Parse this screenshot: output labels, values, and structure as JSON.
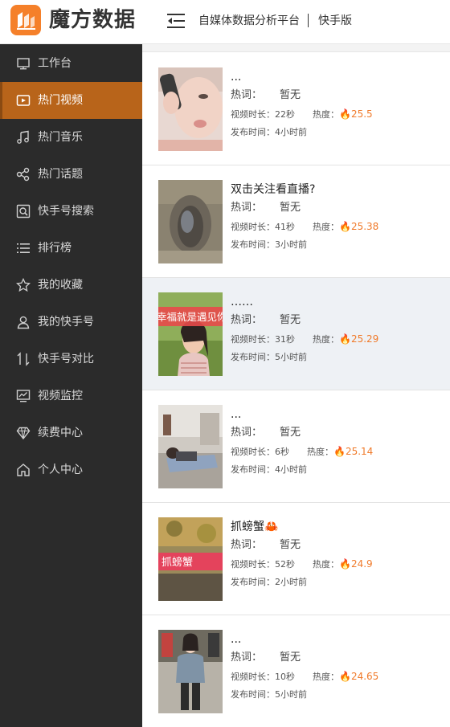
{
  "header": {
    "brand": "魔方数据",
    "platform": "自媒体数据分析平台",
    "edition": "快手版",
    "accent_color": "#f5802a"
  },
  "sidebar": {
    "items": [
      {
        "label": "工作台",
        "icon": "monitor-icon"
      },
      {
        "label": "热门视频",
        "icon": "play-icon",
        "active": true
      },
      {
        "label": "热门音乐",
        "icon": "music-note-icon"
      },
      {
        "label": "热门话题",
        "icon": "share-nodes-icon"
      },
      {
        "label": "快手号搜索",
        "icon": "search-box-icon"
      },
      {
        "label": "排行榜",
        "icon": "list-icon"
      },
      {
        "label": "我的收藏",
        "icon": "star-icon"
      },
      {
        "label": "我的快手号",
        "icon": "user-icon"
      },
      {
        "label": "快手号对比",
        "icon": "compare-arrows-icon"
      },
      {
        "label": "视频监控",
        "icon": "chart-monitor-icon"
      },
      {
        "label": "续费中心",
        "icon": "diamond-icon"
      },
      {
        "label": "个人中心",
        "icon": "home-icon"
      }
    ],
    "active_color": "#b8641a"
  },
  "videos": [
    {
      "title": "...",
      "keyword_label": "热词：",
      "keyword": "暂无",
      "duration_label": "视频时长：",
      "duration": "22秒",
      "heat_label": "热度：",
      "heat": "25.5",
      "publish_label": "发布时间：",
      "publish": "4小时前"
    },
    {
      "title": "双击关注看直播?",
      "keyword_label": "热词：",
      "keyword": "暂无",
      "duration_label": "视频时长：",
      "duration": "41秒",
      "heat_label": "热度：",
      "heat": "25.38",
      "publish_label": "发布时间：",
      "publish": "3小时前"
    },
    {
      "title": "……",
      "keyword_label": "热词：",
      "keyword": "暂无",
      "duration_label": "视频时长：",
      "duration": "31秒",
      "heat_label": "热度：",
      "heat": "25.29",
      "publish_label": "发布时间：",
      "publish": "5小时前",
      "thumb_text": "幸福就是遇见你"
    },
    {
      "title": "...",
      "keyword_label": "热词：",
      "keyword": "暂无",
      "duration_label": "视频时长：",
      "duration": "6秒",
      "heat_label": "热度：",
      "heat": "25.14",
      "publish_label": "发布时间：",
      "publish": "4小时前"
    },
    {
      "title": "抓螃蟹🦀",
      "keyword_label": "热词：",
      "keyword": "暂无",
      "duration_label": "视频时长：",
      "duration": "52秒",
      "heat_label": "热度：",
      "heat": "24.9",
      "publish_label": "发布时间：",
      "publish": "2小时前",
      "thumb_text": "抓螃蟹"
    },
    {
      "title": "...",
      "keyword_label": "热词：",
      "keyword": "暂无",
      "duration_label": "视频时长：",
      "duration": "10秒",
      "heat_label": "热度：",
      "heat": "24.65",
      "publish_label": "发布时间：",
      "publish": "5小时前"
    }
  ],
  "heat_color": "#f07a2a"
}
